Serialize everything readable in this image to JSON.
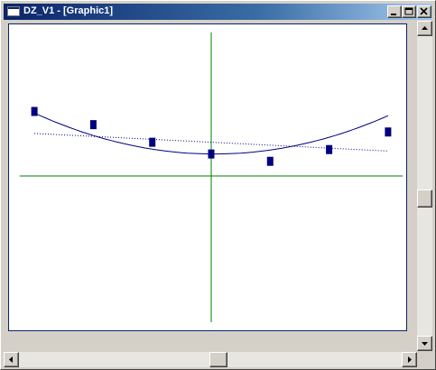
{
  "window": {
    "title": "DZ_V1 - [Graphic1]"
  },
  "icons": {
    "app": "app-window-icon",
    "minimize": "minimize-icon",
    "maximize": "maximize-icon",
    "close": "close-icon",
    "up": "arrow-up-icon",
    "down": "arrow-down-icon",
    "left": "arrow-left-icon",
    "right": "arrow-right-icon"
  },
  "colors": {
    "titlebar_start": "#0a246a",
    "axes": "#008000",
    "curve": "#000080",
    "points": "#000080"
  },
  "chart_data": {
    "type": "scatter",
    "title": "",
    "xlabel": "",
    "ylabel": "",
    "xlim": [
      -3.25,
      3.25
    ],
    "ylim": [
      -2.5,
      2.5
    ],
    "points": {
      "x": [
        -3,
        -2,
        -1,
        0,
        1,
        2,
        3
      ],
      "y": [
        2.2,
        1.75,
        1.15,
        0.75,
        0.5,
        0.9,
        1.5
      ]
    },
    "quadratic_fit": {
      "a": 0.15,
      "b": -0.015,
      "c": 0.75,
      "x_range": [
        -3,
        3
      ]
    },
    "linear_fit": {
      "slope": -0.1,
      "intercept": 1.15,
      "x_range": [
        -3,
        3
      ]
    },
    "grid": false,
    "legend": "none"
  }
}
